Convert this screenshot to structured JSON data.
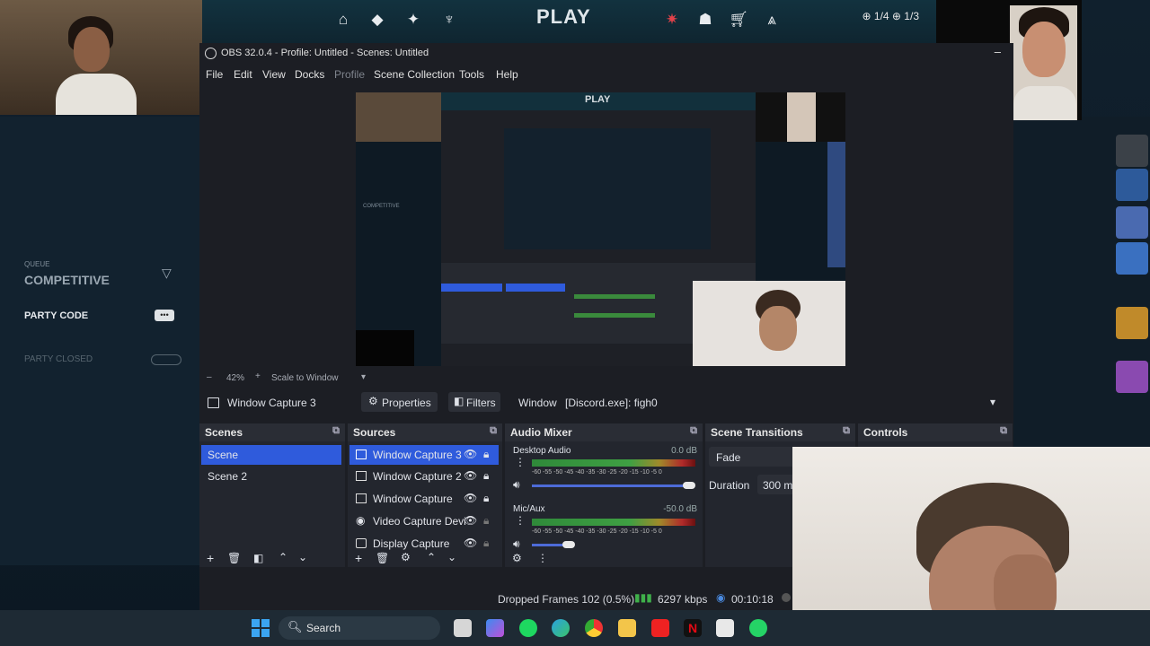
{
  "game": {
    "play_label": "PLAY",
    "counters": "⊕ 1/4  ⊕ 1/3",
    "queue_label": "QUEUE",
    "queue_value": "COMPETITIVE",
    "party_code": "PARTY CODE",
    "party_closed": "PARTY CLOSED"
  },
  "obs": {
    "title": "OBS 32.0.4 - Profile: Untitled - Scenes: Untitled",
    "menu": [
      "File",
      "Edit",
      "View",
      "Docks",
      "Profile",
      "Scene Collection",
      "Tools",
      "Help"
    ],
    "zoom": "42%",
    "scale_mode": "Scale to Window",
    "selected_source": "Window Capture 3",
    "properties_label": "Properties",
    "filters_label": "Filters",
    "window_label": "Window",
    "window_value": "[Discord.exe]: figh0",
    "docks": {
      "scenes": {
        "title": "Scenes",
        "items": [
          "Scene",
          "Scene 2"
        ]
      },
      "sources": {
        "title": "Sources",
        "items": [
          "Window Capture 3",
          "Window Capture 2",
          "Window Capture",
          "Video Capture Devi",
          "Display Capture"
        ]
      },
      "audio": {
        "title": "Audio Mixer",
        "channels": [
          {
            "name": "Desktop Audio",
            "db": "0.0 dB"
          },
          {
            "name": "Mic/Aux",
            "db": "-50.0 dB"
          }
        ],
        "scale": "-60 -55 -50 -45 -40 -35 -30 -25 -20 -15 -10 -5 0"
      },
      "transitions": {
        "title": "Scene Transitions",
        "transition": "Fade",
        "duration_label": "Duration",
        "duration_value": "300 ms"
      },
      "controls": {
        "title": "Controls"
      }
    },
    "status": {
      "dropped": "Dropped Frames 102 (0.5%)",
      "bitrate": "6297 kbps",
      "time": "00:10:18"
    }
  },
  "taskbar": {
    "search": "Search"
  },
  "colors": {
    "accent": "#2f5bdc",
    "obs_bg": "#1c1e24",
    "dock_bg": "#23262e"
  }
}
